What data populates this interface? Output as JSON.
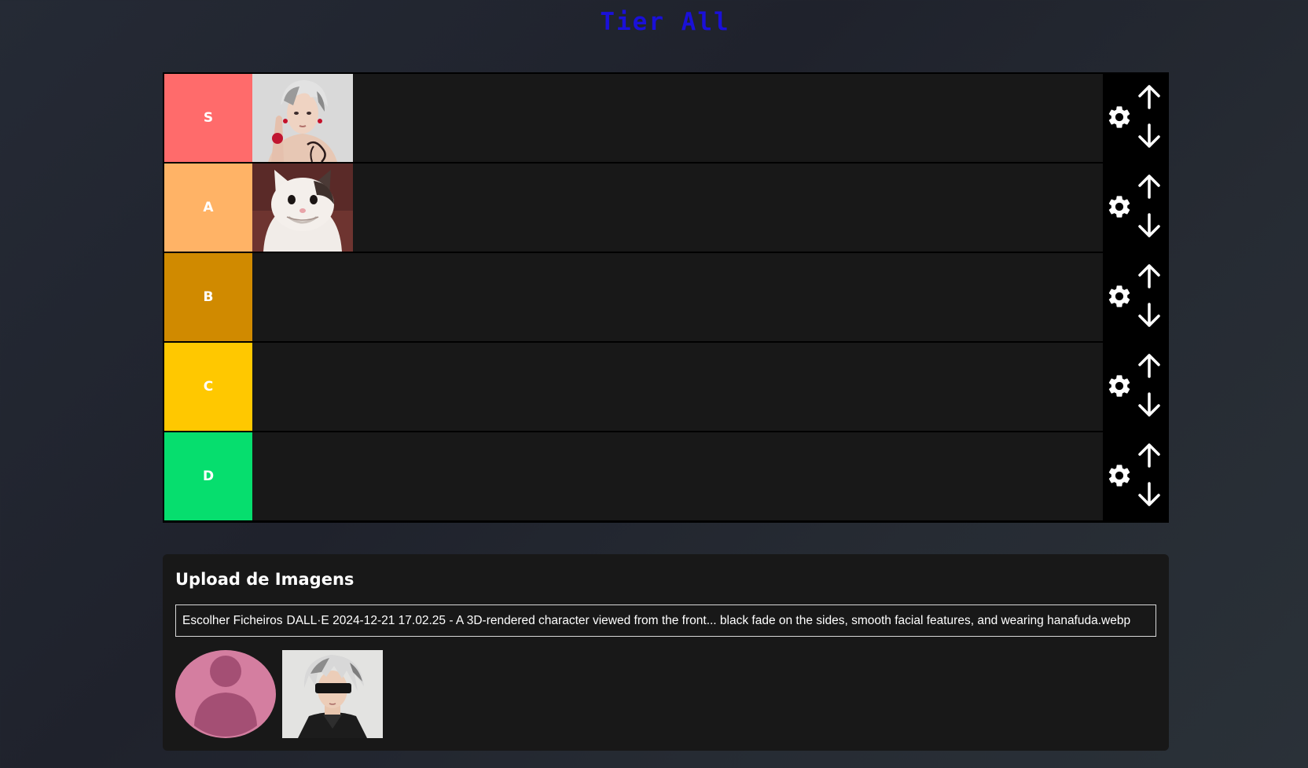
{
  "header": {
    "title": "Tier All"
  },
  "tiers": [
    {
      "label": "S",
      "color": "#ff6b6b",
      "items": [
        "anime-character-portrait"
      ]
    },
    {
      "label": "A",
      "color": "#ffb366",
      "items": [
        "smiling-cat-photo"
      ]
    },
    {
      "label": "B",
      "color": "#d08a00",
      "items": []
    },
    {
      "label": "C",
      "color": "#ffc800",
      "items": []
    },
    {
      "label": "D",
      "color": "#06de6e",
      "items": []
    }
  ],
  "tier_controls": {
    "settings_icon": "gear-icon",
    "move_up_icon": "arrow-up-icon",
    "move_down_icon": "arrow-down-icon"
  },
  "upload": {
    "title": "Upload de Imagens",
    "choose_button": "Escolher Ficheiros",
    "selected_file": "DALL·E 2024-12-21 17.02.25 - A 3D-rendered character viewed from the front... black fade on the sides, smooth facial features, and wearing hanafuda.webp",
    "pool": [
      "default-avatar-placeholder",
      "blindfolded-anime-character"
    ]
  }
}
